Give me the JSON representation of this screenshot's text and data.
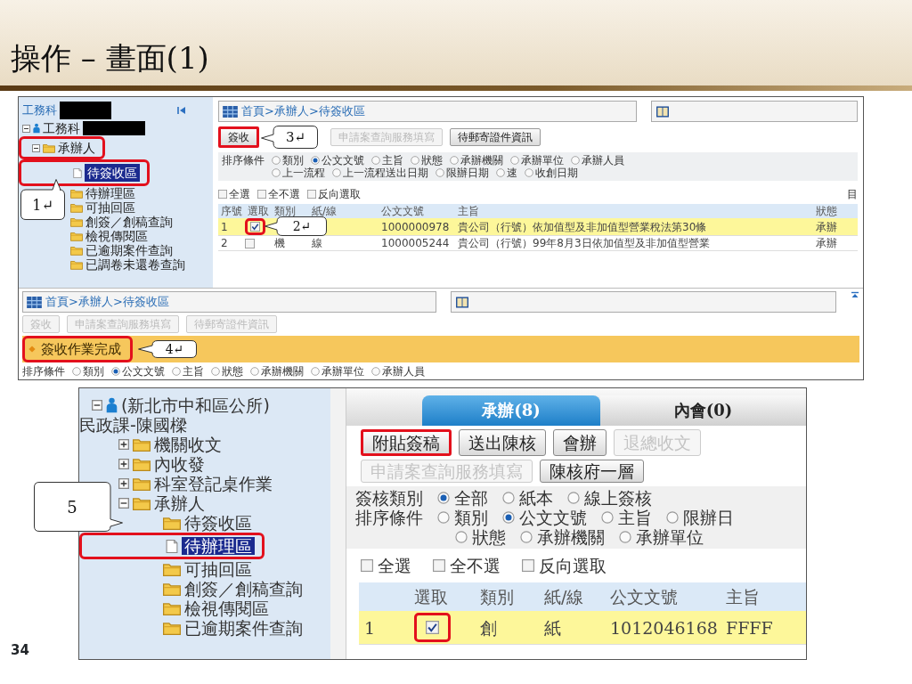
{
  "slide": {
    "title": "操作 – 畫面(1)",
    "page_number": "34"
  },
  "screen_1": {
    "tree": {
      "heading": "工務科",
      "root": {
        "label": "工務科",
        "expanded": true
      },
      "items": [
        {
          "label": "承辦人",
          "kind": "folder",
          "expanded": true,
          "highlighted": true,
          "children": [
            {
              "label": "待簽收區",
              "kind": "document",
              "selected": true,
              "highlighted": true
            },
            {
              "label": "待辦理區",
              "kind": "folder",
              "selected": false,
              "highlighted": false
            },
            {
              "label": "可抽回區",
              "kind": "folder",
              "selected": false,
              "highlighted": false
            },
            {
              "label": "創簽／創稿查詢",
              "kind": "folder",
              "selected": false,
              "highlighted": false
            },
            {
              "label": "檢視傳閱區",
              "kind": "folder",
              "selected": false,
              "highlighted": false
            },
            {
              "label": "已逾期案件查詢",
              "kind": "folder",
              "selected": false,
              "highlighted": false
            },
            {
              "label": "已調卷未還卷查詢",
              "kind": "folder",
              "selected": false,
              "highlighted": false
            }
          ]
        }
      ]
    },
    "breadcrumb": "首頁>承辦人>待簽收區",
    "buttons": [
      {
        "label": "簽收",
        "disabled": false,
        "highlighted": true
      },
      {
        "label": "申請案查詢服務填寫",
        "disabled": true,
        "highlighted": false
      },
      {
        "label": "待郵寄證件資訊",
        "disabled": false,
        "highlighted": false
      }
    ],
    "sort": {
      "label": "排序條件",
      "lines": [
        [
          {
            "label": "類別",
            "selected": false
          },
          {
            "label": "公文文號",
            "selected": true
          },
          {
            "label": "主旨",
            "selected": false
          },
          {
            "label": "狀態",
            "selected": false
          },
          {
            "label": "承辦機關",
            "selected": false
          },
          {
            "label": "承辦單位",
            "selected": false
          },
          {
            "label": "承辦人員",
            "selected": false
          }
        ],
        [
          {
            "label": "上一流程",
            "selected": false
          },
          {
            "label": "上一流程送出日期",
            "selected": false
          },
          {
            "label": "限辦日期",
            "selected": false
          },
          {
            "label": "速",
            "selected": false
          },
          {
            "label": "收創日期",
            "selected": false
          }
        ]
      ]
    },
    "checkboxes": [
      {
        "label": "全選",
        "checked": false
      },
      {
        "label": "全不選",
        "checked": false
      },
      {
        "label": "反向選取",
        "checked": false
      }
    ],
    "side_note": "目",
    "table": {
      "columns": [
        "序號",
        "選取",
        "類別",
        "紙/線",
        "公文文號",
        "主旨",
        "狀態"
      ],
      "rows": [
        {
          "no": "1",
          "checked": true,
          "highlighted": true,
          "selected": true,
          "doc_number": "1000000978",
          "subject": "貴公司（行號）依加值型及非加值型營業稅法第30條",
          "status": "承辦"
        },
        {
          "no": "2",
          "checked": false,
          "highlighted": false,
          "selected": false,
          "category": "機",
          "medium": "線",
          "doc_number": "1000005244",
          "subject": "貴公司（行號）99年8月3日依加值型及非加值型營業",
          "status": "承辦"
        }
      ]
    },
    "result": {
      "breadcrumb": "首頁>承辦人>待簽收區",
      "buttons": [
        {
          "label": "簽收",
          "disabled": true
        },
        {
          "label": "申請案查詢服務填寫",
          "disabled": true
        },
        {
          "label": "待郵寄證件資訊",
          "disabled": true
        }
      ],
      "message": "簽收作業完成",
      "message_highlighted": true,
      "sort": {
        "label": "排序條件",
        "options": [
          {
            "label": "類別",
            "selected": false
          },
          {
            "label": "公文文號",
            "selected": true
          },
          {
            "label": "主旨",
            "selected": false
          },
          {
            "label": "狀態",
            "selected": false
          },
          {
            "label": "承辦機關",
            "selected": false
          },
          {
            "label": "承辦單位",
            "selected": false
          },
          {
            "label": "承辦人員",
            "selected": false
          }
        ]
      }
    }
  },
  "screen_2": {
    "tree": {
      "root": {
        "label": "(新北市中和區公所)",
        "sublabel": "民政課-陳國樑",
        "expanded": true
      },
      "items": [
        {
          "label": "機關收文",
          "kind": "folder",
          "expanded": false
        },
        {
          "label": "內收發",
          "kind": "folder",
          "expanded": false
        },
        {
          "label": "科室登記桌作業",
          "kind": "folder",
          "expanded": false
        },
        {
          "label": "承辦人",
          "kind": "folder",
          "expanded": true,
          "children": [
            {
              "label": "待簽收區",
              "kind": "folder",
              "selected": false,
              "highlighted": false
            },
            {
              "label": "待辦理區",
              "kind": "document",
              "selected": true,
              "highlighted": true
            },
            {
              "label": "可抽回區",
              "kind": "folder",
              "selected": false,
              "highlighted": false
            },
            {
              "label": "創簽／創稿查詢",
              "kind": "folder",
              "selected": false,
              "highlighted": false
            },
            {
              "label": "檢視傳閱區",
              "kind": "folder",
              "selected": false,
              "highlighted": false
            },
            {
              "label": "已逾期案件查詢",
              "kind": "folder",
              "selected": false,
              "highlighted": false
            }
          ]
        }
      ]
    },
    "tabs": [
      {
        "label": "承辦(8)",
        "selected": true
      },
      {
        "label": "內會(0)",
        "selected": false
      }
    ],
    "button_rows": [
      [
        {
          "label": "附貼簽稿",
          "disabled": false,
          "highlighted": true
        },
        {
          "label": "送出陳核",
          "disabled": false,
          "highlighted": false
        },
        {
          "label": "會辦",
          "disabled": false,
          "highlighted": false
        },
        {
          "label": "退總收文",
          "disabled": true,
          "highlighted": false
        }
      ],
      [
        {
          "label": "申請案查詢服務填寫",
          "disabled": true,
          "highlighted": false
        },
        {
          "label": "陳核府一層",
          "disabled": false,
          "highlighted": false
        }
      ]
    ],
    "filter": {
      "label": "簽核類別",
      "options": [
        {
          "label": "全部",
          "selected": true
        },
        {
          "label": "紙本",
          "selected": false
        },
        {
          "label": "線上簽核",
          "selected": false
        }
      ]
    },
    "sort": {
      "label": "排序條件",
      "lines": [
        [
          {
            "label": "類別",
            "selected": false
          },
          {
            "label": "公文文號",
            "selected": true
          },
          {
            "label": "主旨",
            "selected": false
          },
          {
            "label": "限辦日",
            "selected": false
          }
        ],
        [
          {
            "label": "狀態",
            "selected": false
          },
          {
            "label": "承辦機關",
            "selected": false
          },
          {
            "label": "承辦單位",
            "selected": false
          }
        ]
      ]
    },
    "checkboxes": [
      {
        "label": "全選",
        "checked": false
      },
      {
        "label": "全不選",
        "checked": false
      },
      {
        "label": "反向選取",
        "checked": false
      }
    ],
    "table": {
      "columns": [
        "選取",
        "類別",
        "紙/線",
        "公文文號",
        "主旨"
      ],
      "rows": [
        {
          "no": "1",
          "checked": true,
          "highlighted": true,
          "selected": true,
          "category": "創",
          "medium": "紙",
          "doc_number": "1012046168",
          "subject": "FFFF"
        }
      ]
    }
  },
  "callouts": [
    {
      "label": "1↵"
    },
    {
      "label": "2↵"
    },
    {
      "label": "3↵"
    },
    {
      "label": "4↵"
    },
    {
      "label": "5"
    }
  ]
}
